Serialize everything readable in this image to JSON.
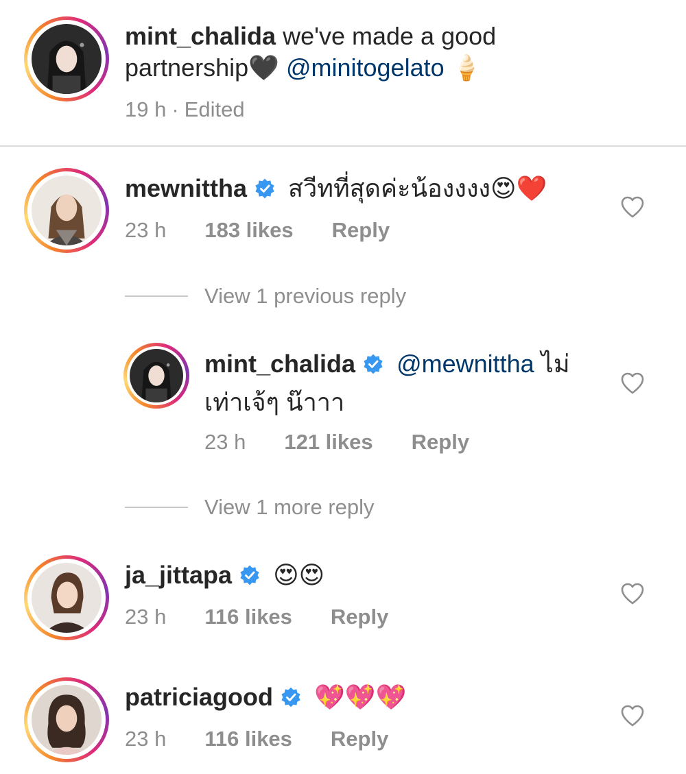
{
  "caption": {
    "username": "mint_chalida",
    "text": "we've made a good",
    "text_line2": "partnership",
    "emoji_heart": "🖤",
    "mention": "@minitogelato",
    "emoji_icecream": "🍦",
    "time": "19 h",
    "separator": "·",
    "edited": "Edited"
  },
  "comments": [
    {
      "username": "mewnittha",
      "verified": true,
      "text": "สวีทที่สุดค่ะน้องงงง",
      "emojis": "😍❤️",
      "time": "23 h",
      "likes": "183 likes",
      "reply_label": "Reply"
    },
    {
      "username": "ja_jittapa",
      "verified": true,
      "emojis": "😍😍",
      "time": "23 h",
      "likes": "116 likes",
      "reply_label": "Reply"
    },
    {
      "username": "patriciagood",
      "verified": true,
      "emojis": "💖💖💖",
      "time": "23 h",
      "likes": "116 likes",
      "reply_label": "Reply"
    }
  ],
  "thread": {
    "view_previous": "View 1 previous reply",
    "view_more": "View 1 more reply"
  },
  "reply": {
    "username": "mint_chalida",
    "verified": true,
    "mention": "@mewnittha",
    "text_part1": "ไม่",
    "text_line2": "เท่าเจ้ๆ น๊าาา",
    "time": "23 h",
    "likes": "121 likes",
    "reply_label": "Reply"
  },
  "colors": {
    "verified_blue": "#3897f0",
    "mention_blue": "#00376b",
    "muted_gray": "#8e8e8e",
    "text": "#262626"
  },
  "icons": {
    "heart": "heart-outline-icon",
    "verified": "verified-badge-icon"
  }
}
